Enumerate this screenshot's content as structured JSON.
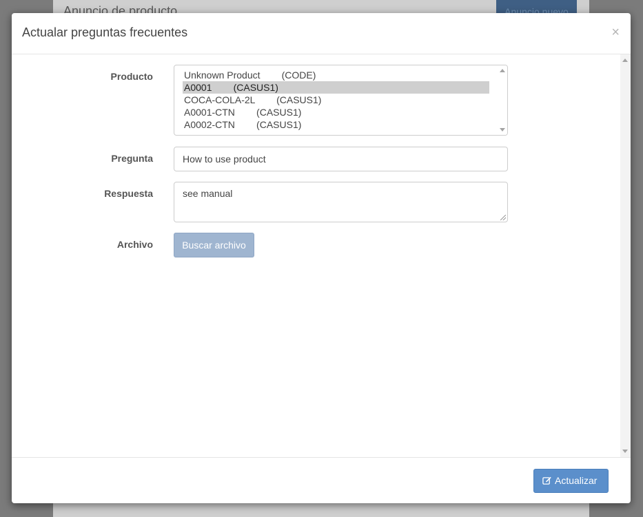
{
  "background": {
    "title": "Anuncio de producto",
    "button_label": "Anuncio nuevo"
  },
  "modal": {
    "title": "Actualar preguntas frecuentes",
    "close_symbol": "×"
  },
  "form": {
    "product_label": "Producto",
    "products": [
      {
        "code": "Unknown Product",
        "group": "(CODE)",
        "selected": false
      },
      {
        "code": "A0001",
        "group": "(CASUS1)",
        "selected": true
      },
      {
        "code": "COCA-COLA-2L",
        "group": "(CASUS1)",
        "selected": false
      },
      {
        "code": "A0001-CTN",
        "group": "(CASUS1)",
        "selected": false
      },
      {
        "code": "A0002-CTN",
        "group": "(CASUS1)",
        "selected": false
      }
    ],
    "question_label": "Pregunta",
    "question_value": "How to use product",
    "answer_label": "Respuesta",
    "answer_value": "see manual",
    "file_label": "Archivo",
    "file_button_label": "Buscar archivo"
  },
  "footer": {
    "update_label": "Actualizar",
    "update_icon": "edit-icon"
  },
  "colors": {
    "primary": "#5b8fcb",
    "disabled_button": "#9fb5d0",
    "selected_row": "#cfcfcf"
  }
}
